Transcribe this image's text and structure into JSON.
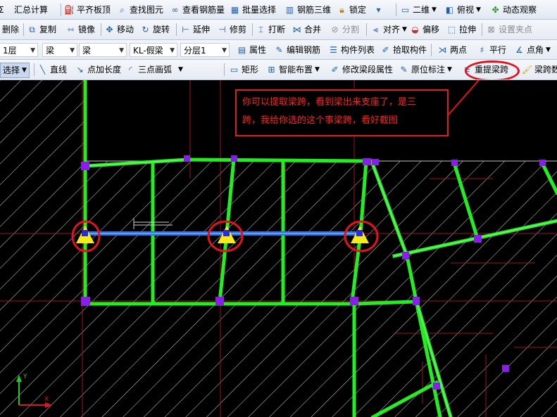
{
  "toolbar1": {
    "left_partial": "Σ",
    "sum": "汇总计算",
    "floor_top": "平齐板顶",
    "find_element": "查找图元",
    "view_rebar_qty": "查看钢筋量",
    "batch_select": "批量选择",
    "rebar_3d": "钢筋三维",
    "lock": "锁定",
    "view_mode": "二维",
    "view_angle": "俯视",
    "dynamic_observe": "动态观察"
  },
  "toolbar2": {
    "delete": "删除",
    "copy": "复制",
    "mirror": "镜像",
    "move": "移动",
    "rotate": "旋转",
    "extend": "延伸",
    "trim": "修剪",
    "break": "打断",
    "merge": "合并",
    "split": "分割",
    "align": "对齐",
    "offset": "偏移",
    "stretch": "拉伸",
    "set_grip": "设置夹点"
  },
  "toolbar3": {
    "floor": "1层",
    "category": "梁",
    "type": "梁",
    "component": "KL-假梁",
    "layer": "分层1",
    "properties": "属性",
    "edit_rebar": "编辑钢筋",
    "component_list": "构件列表",
    "pick_component": "拾取构件",
    "two_points": "两点",
    "parallel": "平行",
    "point_angle": "点角"
  },
  "toolbar4": {
    "select": "选择",
    "line": "直线",
    "point_length": "点加长度",
    "three_point_arc": "三点画弧",
    "rectangle": "矩形",
    "smart_layout": "智能布置",
    "modify_span_props": "修改梁段属性",
    "original_annotation": "原位标注",
    "re_extract_span": "重提梁跨",
    "span_partial": "梁跨数"
  },
  "annotation": {
    "line1": "你可以提取梁跨，看到梁出来支座了，是三",
    "line2": "跨，我给你选的这个事梁跨，看好截图"
  },
  "colors": {
    "beam": "#22ee22",
    "selected_beam": "#2a6ff0",
    "node": "#8a1ee8",
    "support": "#f5ea1a",
    "highlight": "#e3121b",
    "hatch": "#d8d8d8",
    "grid_line": "#c0102a"
  },
  "axis": {
    "x": "X",
    "y": "Y"
  }
}
